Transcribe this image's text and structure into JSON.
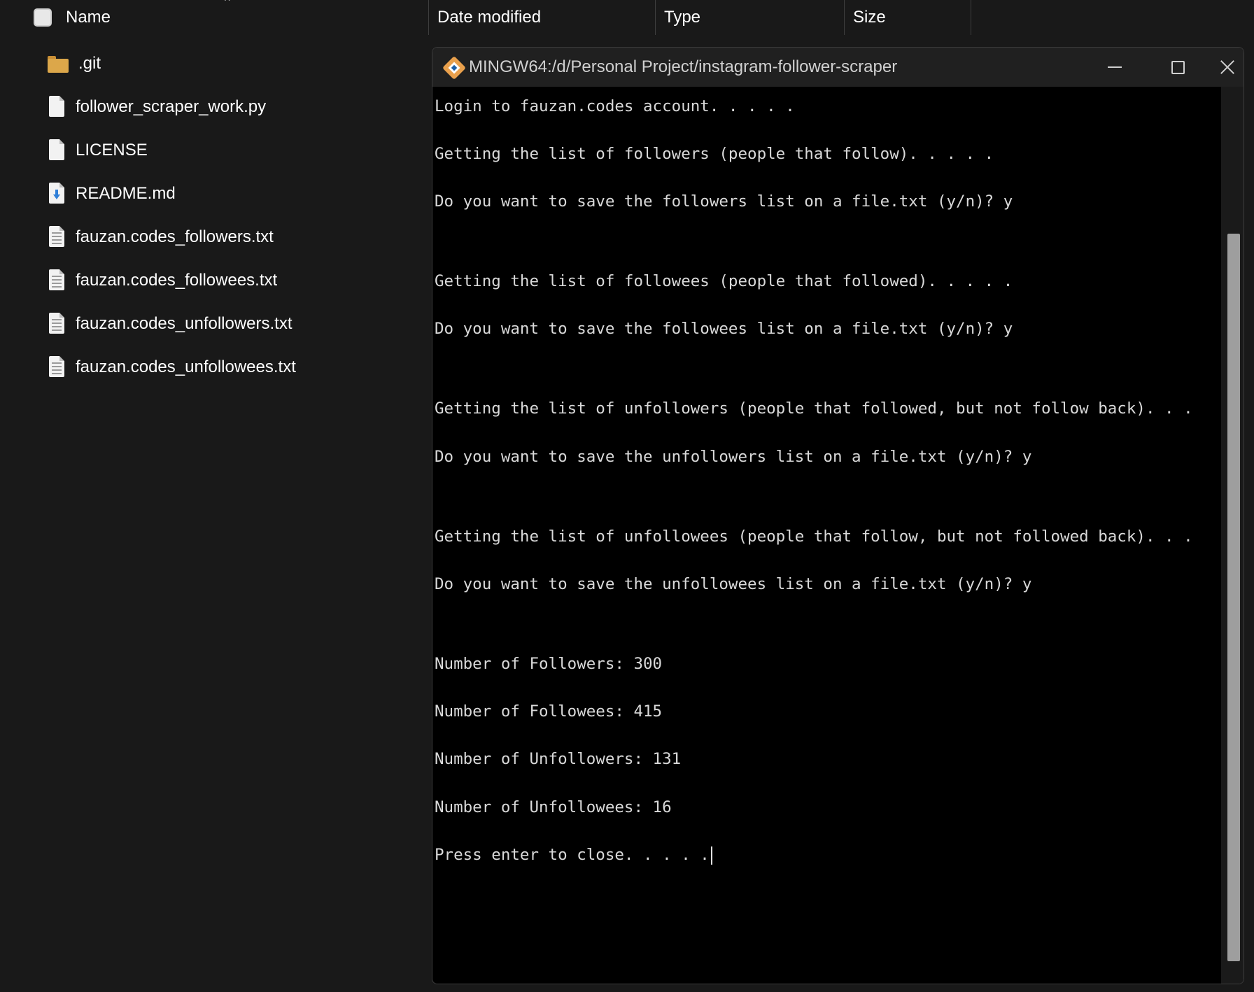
{
  "explorer": {
    "columns": {
      "name": "Name",
      "date_modified": "Date modified",
      "type": "Type",
      "size": "Size"
    },
    "files": [
      {
        "name": ".git",
        "icon": "folder-icon"
      },
      {
        "name": "follower_scraper_work.py",
        "icon": "file-icon"
      },
      {
        "name": "LICENSE",
        "icon": "file-icon"
      },
      {
        "name": "README.md",
        "icon": "markdown-file-icon"
      },
      {
        "name": "fauzan.codes_followers.txt",
        "icon": "text-file-icon"
      },
      {
        "name": "fauzan.codes_followees.txt",
        "icon": "text-file-icon"
      },
      {
        "name": "fauzan.codes_unfollowers.txt",
        "icon": "text-file-icon"
      },
      {
        "name": "fauzan.codes_unfollowees.txt",
        "icon": "text-file-icon"
      }
    ]
  },
  "terminal": {
    "title": "MINGW64:/d/Personal Project/instagram-follower-scraper",
    "icon": "git-bash-icon",
    "lines": [
      "Login to fauzan.codes account. . . . .",
      "Getting the list of followers (people that follow). . . . .",
      "Do you want to save the followers list on a file.txt (y/n)? y",
      "Getting the list of followees (people that followed). . . . .",
      "Do you want to save the followees list on a file.txt (y/n)? y",
      "Getting the list of unfollowers (people that followed, but not follow back). . .",
      "Do you want to save the unfollowers list on a file.txt (y/n)? y",
      "Getting the list of unfollowees (people that follow, but not followed back). . .",
      "Do you want to save the unfollowees list on a file.txt (y/n)? y",
      "Number of Followers: 300",
      "Number of Followees: 415",
      "Number of Unfollowers: 131",
      "Number of Unfollowees: 16",
      "Press enter to close. . . . ."
    ]
  }
}
